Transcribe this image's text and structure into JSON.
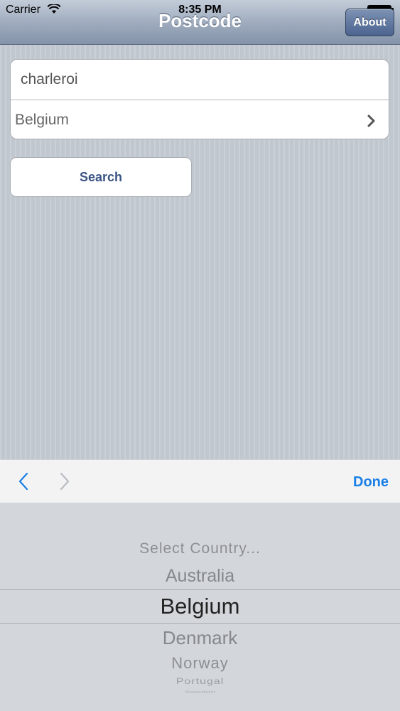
{
  "status_bar": {
    "carrier": "Carrier",
    "time": "8:35 PM"
  },
  "nav": {
    "title": "Postcode",
    "about_label": "About"
  },
  "form": {
    "city_value": "charleroi",
    "country_value": "Belgium",
    "search_label": "Search"
  },
  "toolbar": {
    "done_label": "Done"
  },
  "picker": {
    "options": [
      "Select Country...",
      "Australia",
      "Belgium",
      "Denmark",
      "Norway",
      "Portugal",
      "Sweden"
    ],
    "selected": "Belgium"
  },
  "colors": {
    "accent": "#1a7fe6",
    "button_text": "#3a5383",
    "nav_button": "#4b6490"
  }
}
